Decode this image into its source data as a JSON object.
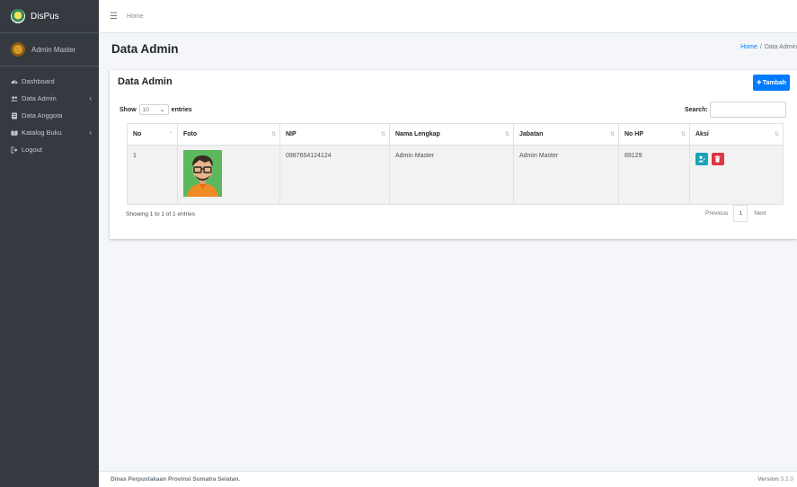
{
  "brand": {
    "name": "DisPus"
  },
  "user": {
    "name": "Admin Master"
  },
  "sidebar": {
    "items": [
      {
        "label": "Dashboard"
      },
      {
        "label": "Data Admin"
      },
      {
        "label": "Data Anggota"
      },
      {
        "label": "Katalog Buku"
      },
      {
        "label": "Logout"
      }
    ]
  },
  "topbar": {
    "home": "Home"
  },
  "header": {
    "title": "Data Admin"
  },
  "breadcrumb": {
    "home": "Home",
    "separator": "/",
    "current": "Data Admin"
  },
  "card": {
    "title": "Data Admin",
    "add_button": "Tambah"
  },
  "table_controls": {
    "show_label": "Show",
    "entries_label": "entries",
    "length_value": "10",
    "search_label": "Search:"
  },
  "table": {
    "headers": [
      "No",
      "Foto",
      "NIP",
      "Nama Lengkap",
      "Jabatan",
      "No HP",
      "Aksi"
    ],
    "rows": [
      {
        "no": "1",
        "nip": "0987654124124",
        "nama": "Admin Master",
        "jabatan": "Admin Master",
        "hp": "89129"
      }
    ]
  },
  "pagination": {
    "info": "Showing 1 to 1 of 1 entries",
    "previous": "Previous",
    "page": "1",
    "next": "Next"
  },
  "footer": {
    "text": "Dinas Perpustakaan Provinsi Sumatra Selatan.",
    "version_label": "Version",
    "version": "3.2.0"
  },
  "colors": {
    "sidebar": "#343a40",
    "primary": "#007bff",
    "info": "#17a2b8",
    "danger": "#dc3545"
  }
}
